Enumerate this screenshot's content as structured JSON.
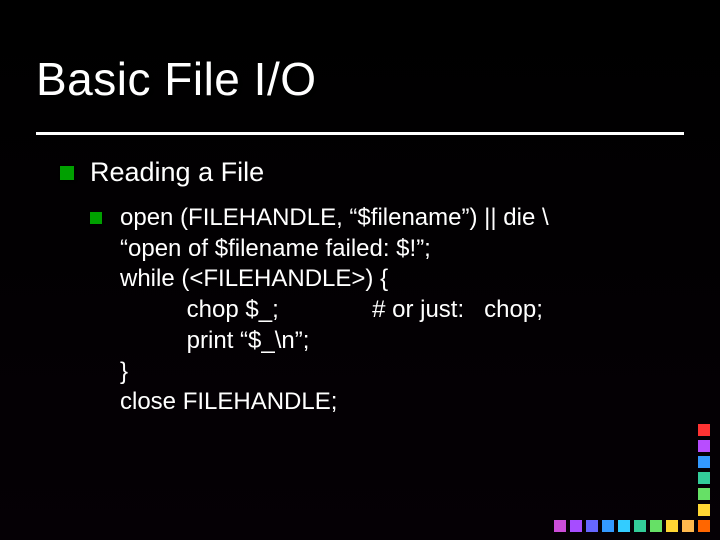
{
  "title": "Basic File I/O",
  "b1_label": "Reading a File",
  "codebullet": "open",
  "code": {
    "l1": " (FILEHANDLE, “$filename”) || die \\",
    "l2": "“open of $filename failed: $!”;",
    "l3": "while (<FILEHANDLE>) {",
    "l4": "          chop $_;              # or just:   chop;",
    "l5": "          print “$_\\n”;",
    "l6": "}",
    "l7": "close FILEHANDLE;"
  },
  "deco": {
    "col": [
      "#ff3333",
      "#b84dff",
      "#3399ff",
      "#33cc99",
      "#66e066",
      "#ffd633"
    ],
    "row": [
      "#cc4dd9",
      "#a64dff",
      "#6666ff",
      "#3399ff",
      "#33ccff",
      "#33cc99",
      "#66e066",
      "#ffd633",
      "#ffb84d",
      "#ff6600"
    ]
  }
}
